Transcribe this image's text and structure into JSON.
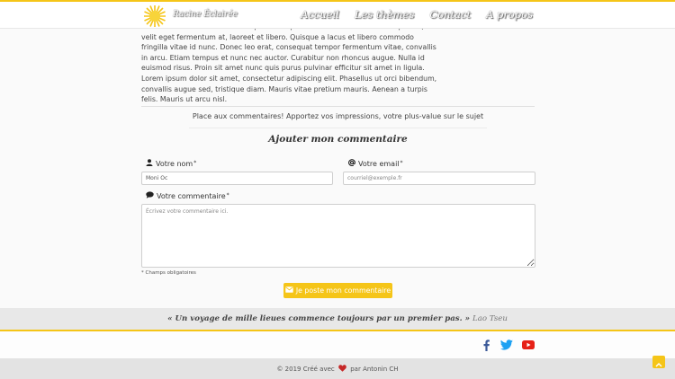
{
  "header": {
    "brand": "Racine Éclairée",
    "nav": [
      "Accueil",
      "Les thèmes",
      "Contact",
      "A propos"
    ]
  },
  "article": {
    "text": "Maecenas ut tortor vel lorem imperdiet dapibus in vitae est. Praesent vulputate, velit eget fermentum at, laoreet et libero. Quisque a lacus et libero commodo fringilla vitae id nunc. Donec leo erat, consequat tempor fermentum vitae, convallis in arcu. Etiam tempus et nunc nec auctor. Curabitur non rhoncus augue. Nulla id euismod risus. Proin sit amet nunc quis purus pulvinar efficitur sit amet in ligula. Lorem ipsum dolor sit amet, consectetur adipiscing elit. Phasellus ut orci bibendum, convallis augue sed, tristique diam. Mauris vitae pretium mauris. Aenean a turpis felis. Mauris ut arcu nisl."
  },
  "comments": {
    "invite": "Place aux commentaires! Apportez vos impressions, votre plus-value sur le sujet",
    "title": "Ajouter mon commentaire",
    "name_label": "Votre nom",
    "name_value": "Moni Oc",
    "email_label": "Votre email",
    "email_placeholder": "courriel@exemple.fr",
    "comment_label": "Votre commentaire",
    "comment_placeholder": "Écrivez votre commentaire ici.",
    "required_mark": "*",
    "required_note": "* Champs obligatoires",
    "submit_label": "Je poste mon commentaire"
  },
  "quote": {
    "text": "« Un voyage de mille lieues commence toujours par un premier pas. »",
    "author": "Lao Tseu"
  },
  "footer": {
    "copyright_before": "© 2019 Créé avec",
    "copyright_after": "par Antonin CH"
  },
  "icons": {
    "logo": "sun-logo-icon",
    "name": "user-icon",
    "email": "at-icon",
    "comment": "comment-icon",
    "submit": "envelope-icon",
    "heart": "heart-icon",
    "facebook": "facebook-icon",
    "twitter": "twitter-icon",
    "youtube": "youtube-icon",
    "to_top": "chevron-up-icon"
  },
  "colors": {
    "accent": "#f5c518",
    "heart": "#c62828",
    "facebook": "#3b5998",
    "twitter": "#1da1f2",
    "youtube": "#e62117"
  }
}
